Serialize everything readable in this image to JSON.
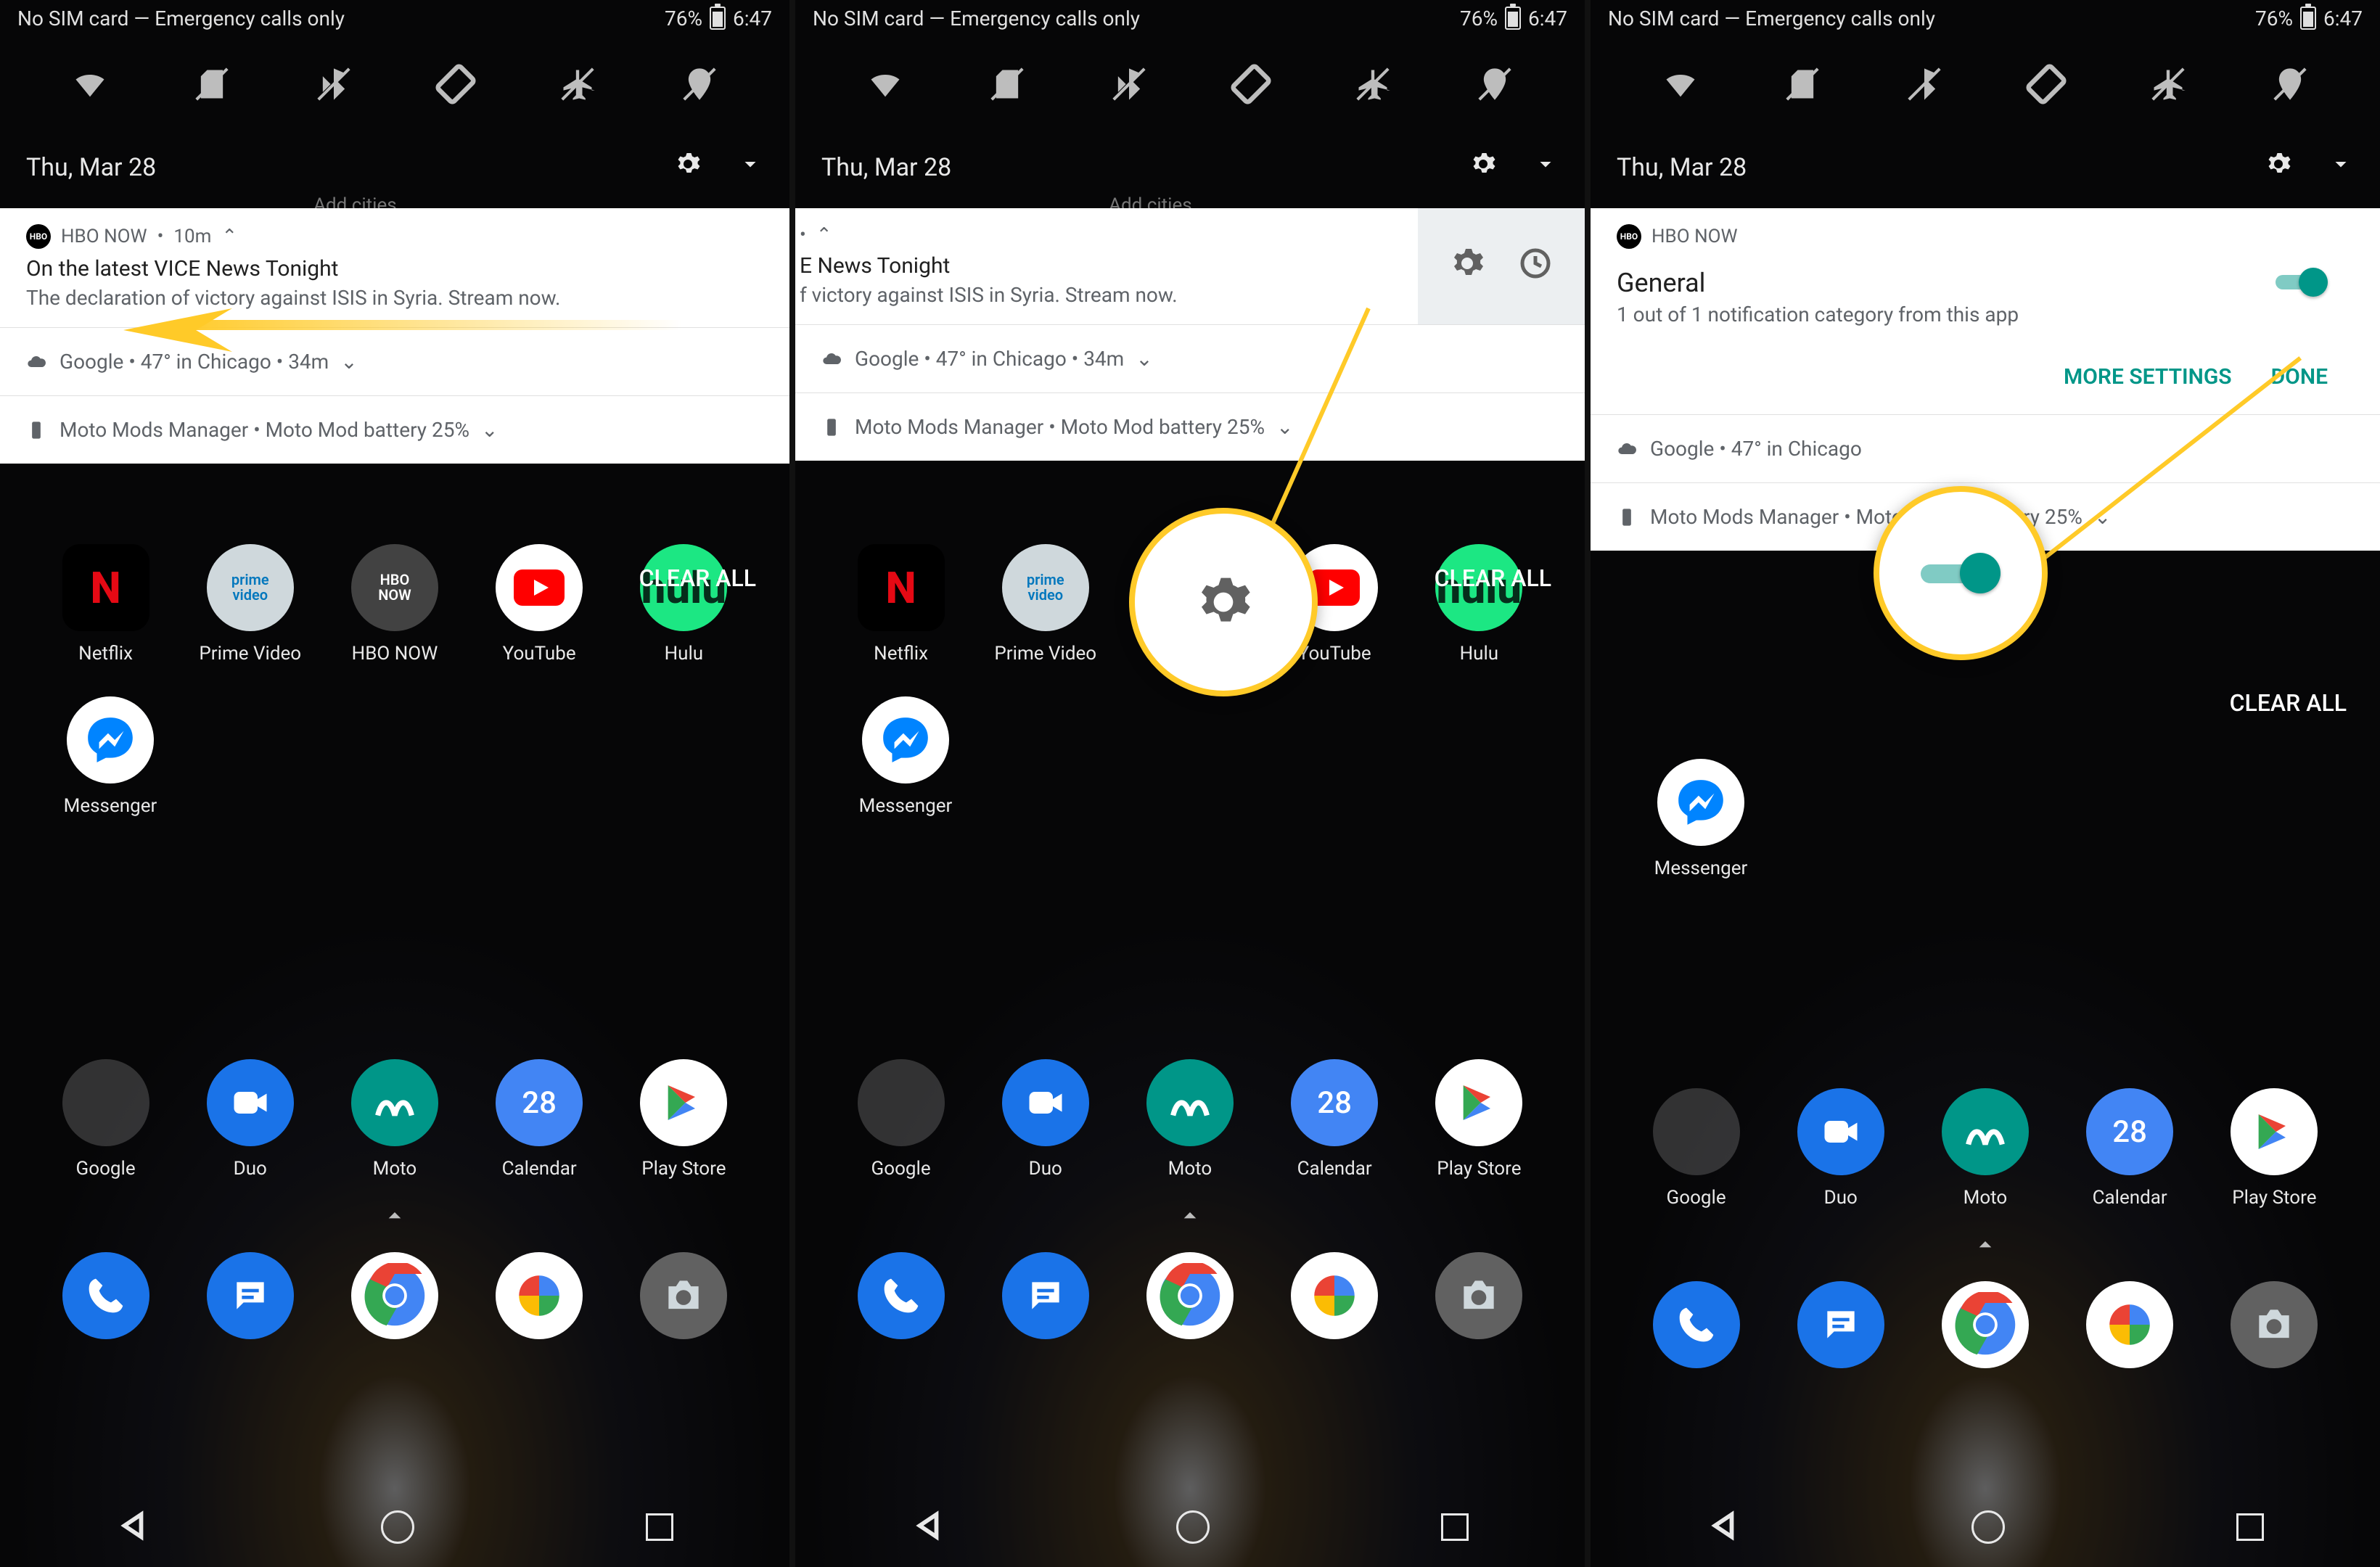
{
  "status": {
    "left": "No SIM card — Emergency calls only",
    "battery": "76%",
    "time": "6:47"
  },
  "date": "Thu, Mar 28",
  "notif_hbo": {
    "app": "HBO NOW",
    "age": "10m",
    "title": "On the latest VICE News Tonight",
    "body": "The declaration of victory against ISIS in Syria. Stream now.",
    "title_trunc": "E News Tonight",
    "body_trunc": "f victory against ISIS in Syria. Stream now."
  },
  "notif_google": "Google • 47° in Chicago • 34m",
  "notif_google_trunc": "Google • 47° in Chicago",
  "notif_moto": "Moto Mods Manager • Moto Mod battery 25%",
  "notif_moto_trunc": "Moto Mods Manager • Moto                   ttery 25%",
  "general": {
    "app": "HBO NOW",
    "heading": "General",
    "sub": "1 out of 1 notification category from this app",
    "more": "MORE SETTINGS",
    "done": "DONE"
  },
  "clear_all": "CLEAR ALL",
  "apps_row1": [
    {
      "label": "Netflix",
      "bg": "#000",
      "fg": "#E50914",
      "glyph": "N",
      "square": true
    },
    {
      "label": "Prime Video",
      "bg": "#cfd8dc",
      "fg": "#0277bd",
      "text": "prime\\nvideo",
      "circle": true
    },
    {
      "label": "HBO NOW",
      "bg": "#424242",
      "fg": "#fff",
      "text": "HBO\\nNOW",
      "circle": true
    },
    {
      "label": "YouTube",
      "bg": "#fff",
      "fg": "#f00",
      "yt": true,
      "circle": true
    },
    {
      "label": "Hulu",
      "bg": "#1ce783",
      "fg": "#062d1b",
      "glyph": "hulu",
      "circle": true
    }
  ],
  "apps_row2": [
    {
      "label": "Messenger",
      "bg": "#0084ff",
      "msg": true,
      "circle": true
    }
  ],
  "apps_row3": [
    {
      "label": "Google",
      "folder": true
    },
    {
      "label": "Duo",
      "bg": "#1a73e8",
      "duo": true,
      "circle": true
    },
    {
      "label": "Moto",
      "bg": "#009688",
      "moto": true,
      "circle": true
    },
    {
      "label": "Calendar",
      "bg": "#4285f4",
      "cal": "28",
      "circle": true
    },
    {
      "label": "Play Store",
      "bg": "#fff",
      "play": true,
      "circle": true
    }
  ],
  "dock": [
    {
      "bg": "#1a73e8",
      "phone": true
    },
    {
      "bg": "#1a73e8",
      "sms": true
    },
    {
      "chrome": true
    },
    {
      "photos": true
    },
    {
      "bg": "#616161",
      "camera": true
    }
  ],
  "ghost": "Add cities"
}
